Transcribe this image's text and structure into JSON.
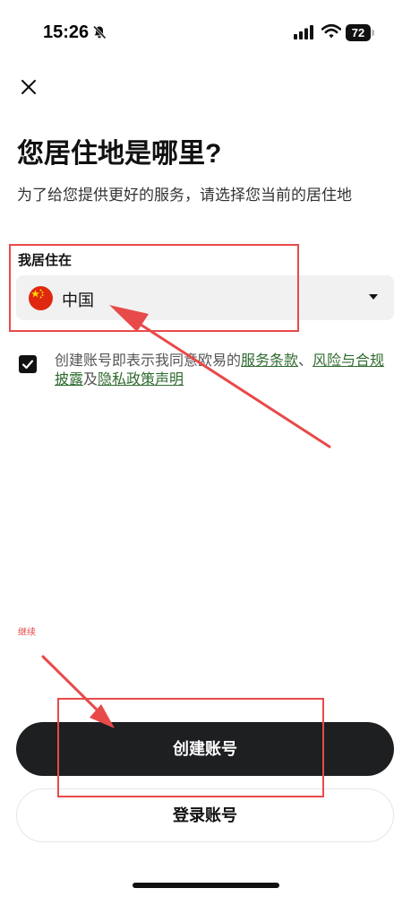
{
  "status_bar": {
    "time": "15:26",
    "battery": "72",
    "icons": [
      "bell-muted-icon",
      "signal-icon",
      "wifi-icon",
      "battery-icon"
    ]
  },
  "header": {
    "close_icon": "close-icon",
    "title": "您居住地是哪里?",
    "subtitle": "为了给您提供更好的服务，请选择您当前的居住地"
  },
  "residence": {
    "label": "我居住在",
    "country": "中国",
    "flag_icon": "china-flag-icon",
    "dropdown_icon": "caret-down-icon"
  },
  "terms": {
    "checked": true,
    "prefix": "创建账号即表示我同意欧易的",
    "link_service": "服务条款",
    "separator": "、",
    "link_risk": "风险与合规披露",
    "conjunction": "及",
    "link_privacy": "隐私政策声明"
  },
  "continue_note": "继续",
  "buttons": {
    "create_account": "创建账号",
    "login": "登录账号"
  },
  "colors": {
    "primary_button": "#1d1f21",
    "link": "#2f6b2f",
    "annotation": "#e84a4a",
    "select_bg": "#f1f1f1"
  }
}
